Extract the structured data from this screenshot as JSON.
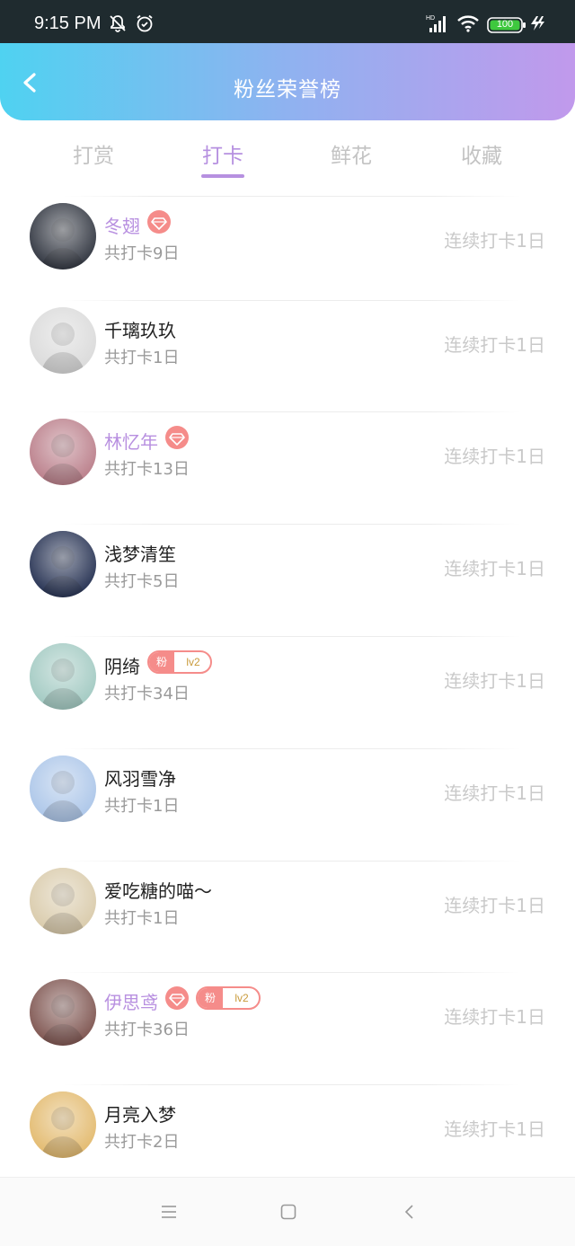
{
  "status_bar": {
    "time": "9:15 PM",
    "battery": "100",
    "icons": [
      "bell-off-icon",
      "alarm-icon",
      "signal-icon",
      "wifi-icon",
      "battery-icon",
      "charging-icon"
    ]
  },
  "header": {
    "title": "粉丝荣誉榜",
    "back_icon": "chevron-left-icon",
    "gradient": [
      "#4fd2f1",
      "#c199ec"
    ]
  },
  "tabs": [
    {
      "label": "打赏",
      "active": false
    },
    {
      "label": "打卡",
      "active": true
    },
    {
      "label": "鲜花",
      "active": false
    },
    {
      "label": "收藏",
      "active": false
    }
  ],
  "accent_color": "#b690e0",
  "badge_color": "#f58c8a",
  "fans": [
    {
      "name": "冬翅",
      "vip": true,
      "diamond": true,
      "fan_badge": null,
      "total": "共打卡9日",
      "streak": "连续打卡1日",
      "avatar_color": "#2a2f3a"
    },
    {
      "name": "千璃玖玖",
      "vip": false,
      "diamond": false,
      "fan_badge": null,
      "total": "共打卡1日",
      "streak": "连续打卡1日",
      "avatar_color": "#d9d9d9"
    },
    {
      "name": "林忆年",
      "vip": true,
      "diamond": true,
      "fan_badge": null,
      "total": "共打卡13日",
      "streak": "连续打卡1日",
      "avatar_color": "#b87a86"
    },
    {
      "name": "浅梦清笙",
      "vip": false,
      "diamond": false,
      "fan_badge": null,
      "total": "共打卡5日",
      "streak": "连续打卡1日",
      "avatar_color": "#1f2b4d"
    },
    {
      "name": "阴绮",
      "vip": false,
      "diamond": false,
      "fan_badge": {
        "label": "粉",
        "level": "lv2"
      },
      "total": "共打卡34日",
      "streak": "连续打卡1日",
      "avatar_color": "#9fc8c0"
    },
    {
      "name": "风羽雪净",
      "vip": false,
      "diamond": false,
      "fan_badge": null,
      "total": "共打卡1日",
      "streak": "连续打卡1日",
      "avatar_color": "#a9c4e8"
    },
    {
      "name": "爱吃糖的喵～",
      "vip": false,
      "diamond": false,
      "fan_badge": null,
      "total": "共打卡1日",
      "streak": "连续打卡1日",
      "avatar_color": "#d8c9a8"
    },
    {
      "name": "伊思鸢",
      "vip": true,
      "diamond": true,
      "fan_badge": {
        "label": "粉",
        "level": "lv2"
      },
      "total": "共打卡36日",
      "streak": "连续打卡1日",
      "avatar_color": "#7a4f4a"
    },
    {
      "name": "月亮入梦",
      "vip": false,
      "diamond": false,
      "fan_badge": null,
      "total": "共打卡2日",
      "streak": "连续打卡1日",
      "avatar_color": "#e2b86a"
    }
  ],
  "nav_bar": {
    "icons": [
      "menu-icon",
      "home-square-icon",
      "back-chevron-icon"
    ]
  }
}
